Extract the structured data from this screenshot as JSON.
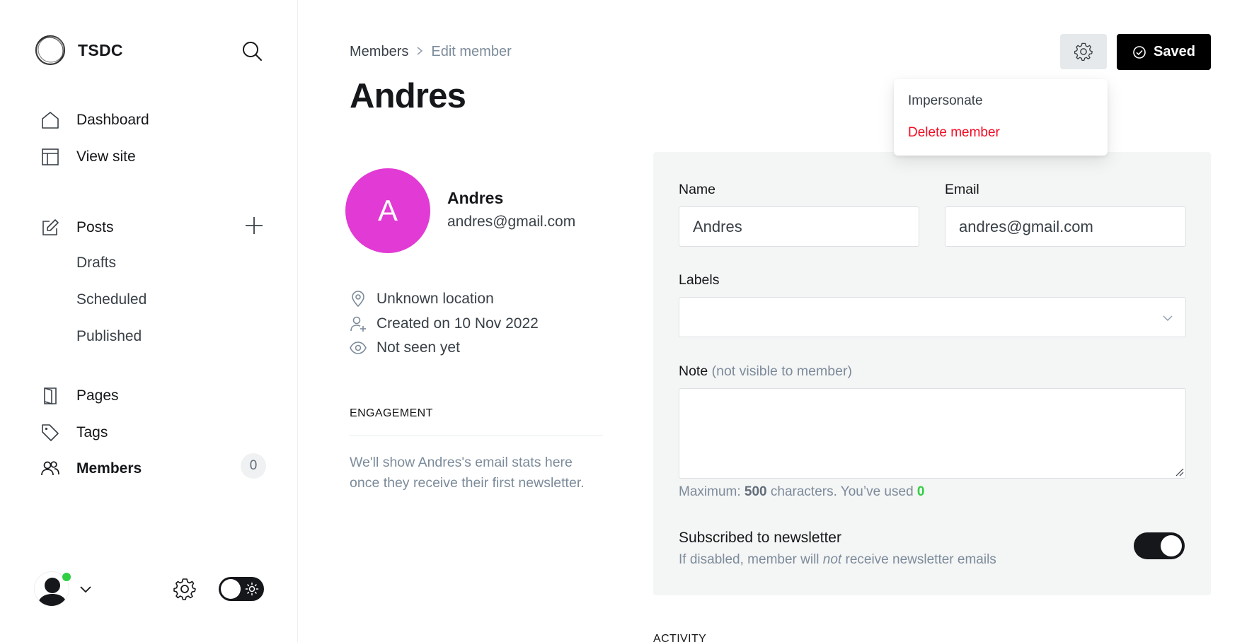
{
  "sidebar": {
    "brand_name": "TSDC",
    "nav": {
      "dashboard": "Dashboard",
      "view_site": "View site",
      "posts": "Posts",
      "drafts": "Drafts",
      "scheduled": "Scheduled",
      "published": "Published",
      "pages": "Pages",
      "tags": "Tags",
      "members": "Members",
      "members_count": "0"
    },
    "icons": {
      "search": "search-icon",
      "home": "home-icon",
      "view_site": "layout-icon",
      "posts": "pencil-square-icon",
      "add_post": "plus-icon",
      "pages": "book-icon",
      "tags": "tag-icon",
      "members": "users-icon",
      "settings": "gear-icon",
      "theme": "sun-icon"
    },
    "online_color": "#30cf43"
  },
  "header": {
    "breadcrumb": {
      "parent": "Members",
      "current": "Edit member"
    },
    "title": "Andres",
    "saved_label": "Saved"
  },
  "menu": {
    "impersonate": "Impersonate",
    "delete": "Delete member"
  },
  "profile": {
    "initial": "A",
    "name": "Andres",
    "email": "andres@gmail.com",
    "avatar_color": "#e23ad4",
    "location": "Unknown location",
    "created": "Created on 10 Nov 2022",
    "seen": "Not seen yet",
    "engagement_heading": "ENGAGEMENT",
    "engagement_text": "We'll show Andres's email stats here once they receive their first newsletter."
  },
  "form": {
    "name_label": "Name",
    "name_value": "Andres",
    "email_label": "Email",
    "email_value": "andres@gmail.com",
    "labels_label": "Labels",
    "note_label": "Note",
    "note_hint": "(not visible to member)",
    "char_prefix": "Maximum: ",
    "char_max": "500",
    "char_middle": " characters. You’ve used ",
    "char_used": "0",
    "subscribed_title": "Subscribed to newsletter",
    "subscribed_desc_1": "If disabled, member will ",
    "subscribed_desc_em": "not",
    "subscribed_desc_2": " receive newsletter emails",
    "subscribed": true
  },
  "activity_heading": "ACTIVITY",
  "colors": {
    "accent_black": "#15171a",
    "danger": "#f50b23",
    "success": "#30cf43"
  }
}
